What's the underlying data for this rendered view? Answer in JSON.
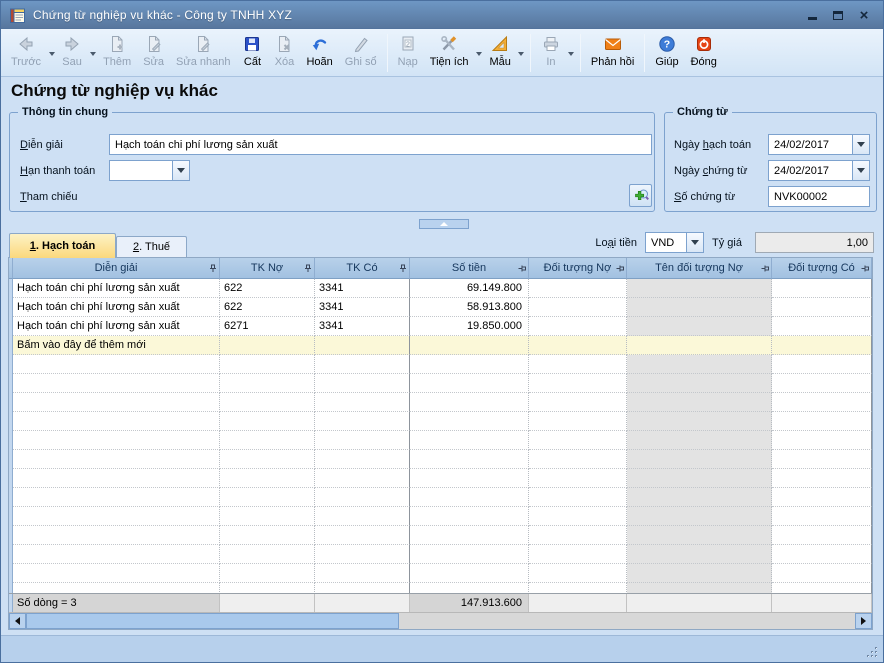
{
  "window": {
    "title": "Chứng từ nghiệp vụ khác - Công ty TNHH XYZ",
    "icon": "notepad-icon",
    "controls": [
      "minimize",
      "maximize",
      "close"
    ]
  },
  "page": {
    "title": "Chứng từ nghiệp vụ khác"
  },
  "toolbar": {
    "buttons": [
      {
        "label": "Trước",
        "icon": "arrow-left-icon",
        "enabled": false,
        "caret": true
      },
      {
        "label": "Sau",
        "icon": "arrow-right-icon",
        "enabled": false,
        "caret": true
      },
      {
        "label": "Thêm",
        "icon": "page-add-icon",
        "enabled": false
      },
      {
        "label": "Sửa",
        "icon": "page-edit-icon",
        "enabled": false
      },
      {
        "label": "Sửa nhanh",
        "icon": "page-edit-icon",
        "enabled": false
      },
      {
        "label": "Cất",
        "icon": "floppy-icon",
        "enabled": true
      },
      {
        "label": "Xóa",
        "icon": "page-delete-icon",
        "enabled": false
      },
      {
        "label": "Hoãn",
        "icon": "undo-icon",
        "enabled": true
      },
      {
        "label": "Ghi sổ",
        "icon": "pencil-icon",
        "enabled": false
      },
      {
        "label": "Nạp",
        "icon": "page-refresh-icon",
        "enabled": false
      },
      {
        "label": "Tiện ích",
        "icon": "tools-icon",
        "enabled": true,
        "caret": true
      },
      {
        "label": "Mẫu",
        "icon": "set-square-icon",
        "enabled": true,
        "caret": true
      },
      {
        "label": "In",
        "icon": "printer-icon",
        "enabled": false,
        "caret": true
      },
      {
        "label": "Phản hồi",
        "icon": "envelope-icon",
        "enabled": true
      },
      {
        "label": "Giúp",
        "icon": "help-icon",
        "enabled": true
      },
      {
        "label": "Đóng",
        "icon": "power-icon",
        "enabled": true
      }
    ]
  },
  "general": {
    "legend": "Thông tin chung",
    "dien_giai": {
      "pre": "",
      "ac": "D",
      "post": "iễn giải",
      "value": "Hạch toán chi phí lương sản xuất"
    },
    "han_thanh_toan": {
      "pre": "",
      "ac": "H",
      "post": "ạn thanh toán",
      "value": ""
    },
    "tham_chieu": {
      "pre": "",
      "ac": "T",
      "post": "ham chiếu"
    }
  },
  "voucher": {
    "legend": "Chứng từ",
    "ngay_hach_toan": {
      "pre": "Ngày ",
      "ac": "h",
      "post": "ạch toán",
      "value": "24/02/2017"
    },
    "ngay_chung_tu": {
      "pre": "Ngày ",
      "ac": "c",
      "post": "hứng từ",
      "value": "24/02/2017"
    },
    "so_chung_tu": {
      "pre": "",
      "ac": "S",
      "post": "ố chứng từ",
      "value": "NVK00002"
    }
  },
  "tabs": [
    {
      "pre": "",
      "ac": "1",
      "post": ". Hạch toán",
      "active": true
    },
    {
      "pre": "",
      "ac": "2",
      "post": ". Thuế",
      "active": false
    }
  ],
  "currency": {
    "loai_tien_label": {
      "pre": "Lo",
      "ac": "ạ",
      "post": "i tiền"
    },
    "loai_tien_value": "VND",
    "ty_gia_label": {
      "pre": "Tỷ ",
      "ac": "g",
      "post": "iá"
    },
    "ty_gia_value": "1,00"
  },
  "grid": {
    "columns": [
      {
        "label": "Diễn giải"
      },
      {
        "label": "TK Nợ"
      },
      {
        "label": "TK Có"
      },
      {
        "label": "Số tiền"
      },
      {
        "label": "Đối tượng Nợ"
      },
      {
        "label": "Tên đối tượng Nợ"
      },
      {
        "label": "Đối tượng Có"
      }
    ],
    "rows": [
      {
        "cells": [
          "Hạch toán chi phí lương sản xuất",
          "622",
          "3341",
          "69.149.800",
          "",
          "",
          ""
        ]
      },
      {
        "cells": [
          "Hạch toán chi phí lương sản xuất",
          "622",
          "3341",
          "58.913.800",
          "",
          "",
          ""
        ]
      },
      {
        "cells": [
          "Hạch toán chi phí lương sản xuất",
          "6271",
          "3341",
          "19.850.000",
          "",
          "",
          ""
        ]
      }
    ],
    "new_row_hint": "Bấm vào đây để thêm mới",
    "summary": {
      "row_count": "Số dòng = 3",
      "total": "147.913.600"
    }
  },
  "colors": {
    "titlebar": "#5d8aba",
    "toolbar_bg": "#d9e9f8",
    "content_bg": "#cee0f4",
    "grid_header": "#abc8e5",
    "active_tab": "#fbd87c",
    "new_row_bg": "#fbf8d8",
    "disabled_column_bg": "#e3e3e3",
    "accent_save": "#2d52c8",
    "accent_feedback": "#f08018",
    "accent_close": "#e64414"
  }
}
